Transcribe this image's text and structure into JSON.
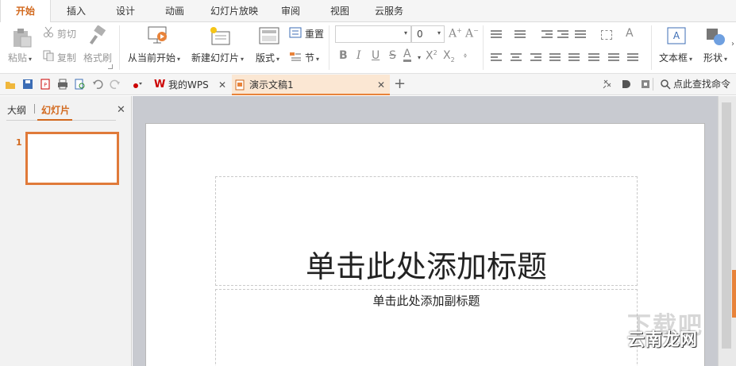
{
  "ribbon_tabs": [
    "开始",
    "插入",
    "设计",
    "动画",
    "幻灯片放映",
    "审阅",
    "视图",
    "云服务"
  ],
  "ribbon": {
    "paste": "粘贴",
    "cut": "剪切",
    "copy": "复制",
    "format_painter": "格式刷",
    "from_current": "从当前开始",
    "new_slide": "新建幻灯片",
    "layout": "版式",
    "reset": "重置",
    "section": "节",
    "font_size": "0",
    "text_box": "文本框",
    "shape": "形状"
  },
  "doc_tabs": {
    "wps": "我的WPS",
    "current": "演示文稿1"
  },
  "search_command": "点此查找命令",
  "panel": {
    "outline_tab": "大纲",
    "slides_tab": "幻灯片",
    "slide_number": "1"
  },
  "slide": {
    "title_placeholder": "单击此处添加标题",
    "subtitle_placeholder": "单击此处添加副标题"
  },
  "watermark": {
    "text": "云南龙网",
    "big": "下载吧"
  },
  "colors": {
    "accent": "#e8833a",
    "active_tab_text": "#d2691e"
  }
}
